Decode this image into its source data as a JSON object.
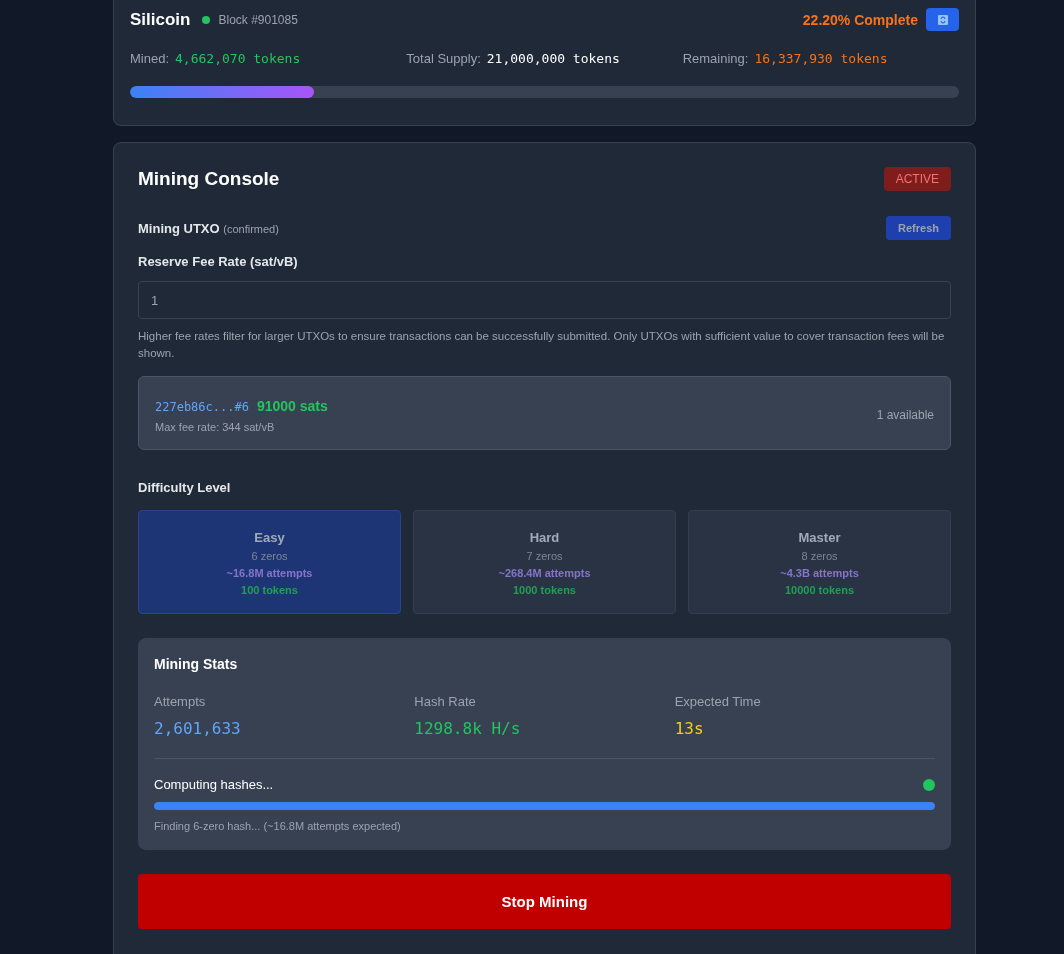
{
  "header": {
    "title": "Silicoin",
    "block": "Block #901085",
    "complete": "22.20% Complete",
    "stats": [
      {
        "label": "Mined:",
        "value": "4,662,070 tokens",
        "color": "#22c55e"
      },
      {
        "label": "Total Supply:",
        "value": "21,000,000 tokens",
        "color": "#ffffff"
      },
      {
        "label": "Remaining:",
        "value": "16,337,930 tokens",
        "color": "#f97316"
      }
    ],
    "level": 0.222
  },
  "console": {
    "title": "Mining Console",
    "status": "ACTIVE",
    "utxo_label": "Mining UTXO",
    "utxo_note": "(confirmed)",
    "refresh": "Refresh",
    "fee_label": "Reserve Fee Rate (sat/vB)",
    "fee_value": "1",
    "fee_help": "Higher fee rates filter for larger UTXOs to ensure transactions can be successfully submitted. Only UTXOs with sufficient value to cover transaction fees will be shown.",
    "utxo": {
      "id": "227eb86c...#6",
      "amount": "91000 sats",
      "max_fee": "Max fee rate: 344 sat/vB",
      "available": "1 available"
    },
    "difficulty_label": "Difficulty Level",
    "difficulties": [
      {
        "name": "Easy",
        "zeros": "6 zeros",
        "attempts": "~16.8M attempts",
        "reward": "100 tokens",
        "selected": true
      },
      {
        "name": "Hard",
        "zeros": "7 zeros",
        "attempts": "~268.4M attempts",
        "reward": "1000 tokens",
        "selected": false
      },
      {
        "name": "Master",
        "zeros": "8 zeros",
        "attempts": "~4.3B attempts",
        "reward": "10000 tokens",
        "selected": false
      }
    ],
    "stats": {
      "title": "Mining Stats",
      "items": [
        {
          "label": "Attempts",
          "value": "2,601,633",
          "color": "#60a5fa"
        },
        {
          "label": "Hash Rate",
          "value": "1298.8k H/s",
          "color": "#22c55e"
        },
        {
          "label": "Expected Time",
          "value": "13s",
          "color": "#facc15"
        }
      ],
      "progress_label": "Computing hashes...",
      "level": 1,
      "progress_note": "Finding 6-zero hash... (~16.8M attempts expected)"
    },
    "stop": "Stop Mining"
  }
}
